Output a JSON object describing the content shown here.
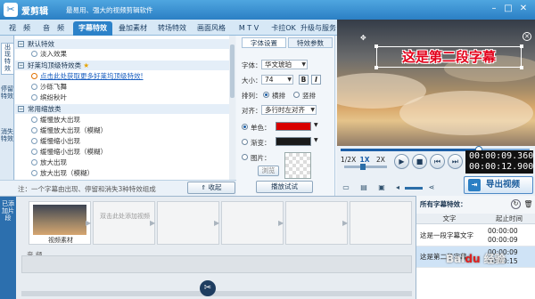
{
  "app": {
    "name": "爱剪辑",
    "slogan": "最易用、强大的视频剪辑软件"
  },
  "tabs": [
    "视　频",
    "音　频",
    "字幕特效",
    "叠加素材",
    "转场特效",
    "画面风格",
    "M T V",
    "卡拉OK",
    "升级与服务"
  ],
  "left_tabs": [
    "出现特效",
    "停留特效",
    "消失特效"
  ],
  "effects": {
    "groups": [
      {
        "label": "默认特效",
        "items": [
          "淡入效果"
        ]
      },
      {
        "label": "好莱坞顶级特效类",
        "items": [
          "点击此处获取更多好莱坞顶级特效!",
          "沙砾飞舞",
          "缤纷秋叶"
        ]
      },
      {
        "label": "常用缩放类",
        "items": [
          "缓慢放大出现",
          "缓慢放大出现（模糊）",
          "缓慢缩小出现",
          "缓慢缩小出现（模糊）",
          "放大出现",
          "放大出现（模糊）"
        ]
      }
    ]
  },
  "hint": {
    "text": "注：一个字幕由出现、停留和消失3种特效组成",
    "collapse_label": "收起"
  },
  "props": {
    "tabs": [
      "字体设置",
      "特效参数"
    ],
    "font_label": "字体：",
    "font_value": "华文琥珀",
    "size_label": "大小：",
    "size_value": "74",
    "bold": "B",
    "italic": "I",
    "layout_label": "排列：",
    "layout_h": "横排",
    "layout_v": "竖排",
    "align_label": "对齐：",
    "align_value": "多行时左对齐",
    "solid_label": "单色：",
    "gradient_label": "渐变：",
    "image_label": "图片：",
    "browse_label": "浏览",
    "preview_button": "播放试试",
    "colors": {
      "solid": "#d80000",
      "gradient": "#1a1a1a"
    }
  },
  "preview": {
    "caption": "这是第二段字幕",
    "caption_color": "#e3001a"
  },
  "player": {
    "speeds": [
      "1/2X",
      "1X",
      "2X"
    ],
    "time_current": "00:00:09.360",
    "time_total": "00:00:12.900",
    "progress": 0.73,
    "export_label": "导出视频"
  },
  "timeline": {
    "side_label": "已添加片段",
    "clip_label": "视频素材",
    "add_hint": "双击此处添加视频",
    "audio_label": "音 频"
  },
  "subtitles": {
    "title": "所有字幕特效：",
    "columns": [
      "文字",
      "起止时间"
    ],
    "rows": [
      {
        "text": "这是一段字幕文字",
        "start": "00:00:00",
        "end": "00:00:09",
        "selected": false
      },
      {
        "text": "这是第二段字幕",
        "start": "00:00:09",
        "end": "00:00:15",
        "selected": true
      }
    ]
  },
  "watermark": "jingyan"
}
